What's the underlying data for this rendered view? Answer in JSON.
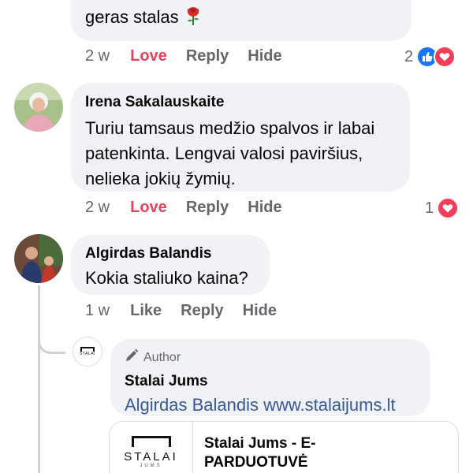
{
  "comment1": {
    "text": "geras stalas",
    "emoji_icon": "rose-icon",
    "time": "2 w",
    "love_label": "Love",
    "reply_label": "Reply",
    "hide_label": "Hide",
    "reaction_count": "2"
  },
  "comment2": {
    "author": "Irena Sakalauskaite",
    "text": "Turiu tamsaus medžio spalvos ir labai patenkinta. Lengvai valosi paviršius, nelieka jokių žymių.",
    "time": "2 w",
    "love_label": "Love",
    "reply_label": "Reply",
    "hide_label": "Hide",
    "reaction_count": "1"
  },
  "comment3": {
    "author": "Algirdas Balandis",
    "text": "Kokia staliuko kaina?",
    "time": "1 w",
    "like_label": "Like",
    "reply_label": "Reply",
    "hide_label": "Hide"
  },
  "reply": {
    "badge": "Author",
    "author": "Stalai Jums",
    "mention": "Algirdas Balandis",
    "link": "www.stalaijums.lt",
    "logo_text": "STALAI",
    "logo_subtext": "JUMS"
  },
  "link_preview": {
    "title": "Stalai Jums - E-PARDUOTUVĖ",
    "logo_text": "STALAI",
    "logo_subtext": "JUMS"
  },
  "colors": {
    "bubble_bg": "#f0f2f5",
    "love": "#e0455b",
    "link": "#385898",
    "muted": "#65676b",
    "like_blue": "#1877f2",
    "love_red": "#f33e58"
  }
}
